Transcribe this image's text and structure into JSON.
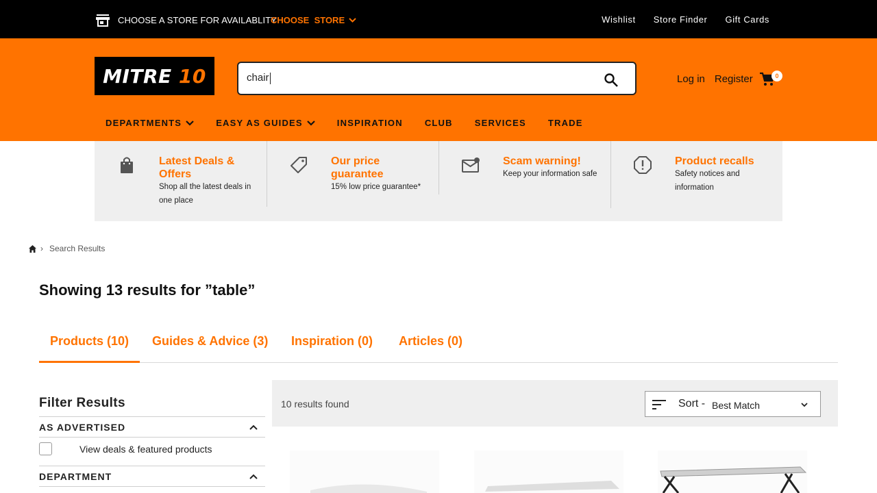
{
  "topbar": {
    "choose_text": "CHOOSE A STORE FOR AVAILABLITY",
    "choose_store": "CHOOSE  STORE",
    "links": [
      "Wishlist",
      "Store Finder",
      "Gift Cards"
    ]
  },
  "header": {
    "logo_word": "MITRE",
    "logo_num": "10",
    "search_value": "chair",
    "login": "Log in",
    "register": "Register",
    "cart_count": "0"
  },
  "nav": {
    "items": [
      "DEPARTMENTS",
      "EASY AS GUIDES",
      "INSPIRATION",
      "CLUB",
      "SERVICES",
      "TRADE"
    ]
  },
  "info": [
    {
      "title_1": "Latest Deals &",
      "title_2": "Offers",
      "sub_1": "Shop all the latest deals in",
      "sub_2": "one place",
      "icon": "shopping-bag-icon"
    },
    {
      "title_1": "Our price",
      "title_2": "guarantee",
      "sub_1": "15% low price guarantee*",
      "icon": "price-tag-icon"
    },
    {
      "title_1": "Scam warning!",
      "sub_1": "Keep your information safe",
      "icon": "mail-alert-icon"
    },
    {
      "title_1": "Product recalls",
      "sub_1": "Safety notices and",
      "sub_2": "information",
      "icon": "alert-circle-icon"
    }
  ],
  "breadcrumb": {
    "current": "Search Results"
  },
  "results": {
    "title": "Showing 13 results for ”table”",
    "count_text": "10 results found"
  },
  "tabs": [
    "Products (10)",
    "Guides & Advice (3)",
    "Inspiration (0)",
    "Articles (0)"
  ],
  "filters": {
    "title": "Filter Results",
    "sections": [
      "AS ADVERTISED",
      "DEPARTMENT"
    ],
    "option": "View deals & featured products"
  },
  "sort": {
    "label": "Sort -",
    "value": "Best Match"
  },
  "colors": {
    "brand_orange": "#ff7300",
    "topbar_black": "#000000",
    "panel_grey": "#efefef"
  }
}
